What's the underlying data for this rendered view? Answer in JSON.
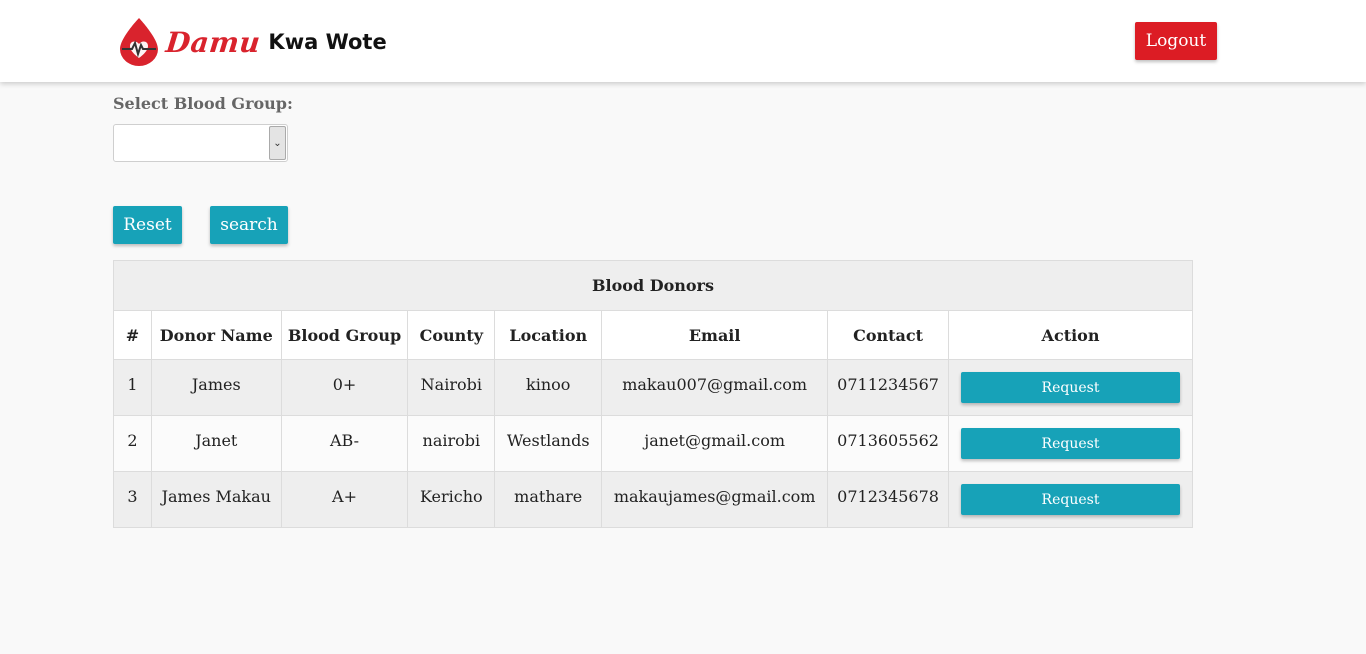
{
  "header": {
    "brand_damu": "Damu",
    "brand_rest": "Kwa Wote",
    "logout_label": "Logout"
  },
  "filter": {
    "label": "Select Blood Group:",
    "selected_value": "",
    "reset_label": "Reset",
    "search_label": "search"
  },
  "table": {
    "caption": "Blood Donors",
    "columns": [
      "#",
      "Donor Name",
      "Blood Group",
      "County",
      "Location",
      "Email",
      "Contact",
      "Action"
    ],
    "rows": [
      {
        "num": "1",
        "name": "James",
        "blood_group": "0+",
        "county": "Nairobi",
        "location": "kinoo",
        "email": "makau007@gmail.com",
        "contact": "0711234567",
        "action": "Request"
      },
      {
        "num": "2",
        "name": "Janet",
        "blood_group": "AB-",
        "county": "nairobi",
        "location": "Westlands",
        "email": "janet@gmail.com",
        "contact": "0713605562",
        "action": "Request"
      },
      {
        "num": "3",
        "name": "James Makau",
        "blood_group": "A+",
        "county": "Kericho",
        "location": "mathare",
        "email": "makaujames@gmail.com",
        "contact": "0712345678",
        "action": "Request"
      }
    ]
  },
  "colors": {
    "brand_red": "#d9232d",
    "logout_red": "#dc1c24",
    "teal": "#17a2b8",
    "page_bg": "#f9f9f9"
  },
  "icons": {
    "logo": "blood-drop-heartbeat-icon",
    "select_arrow": "chevron-down-icon"
  }
}
